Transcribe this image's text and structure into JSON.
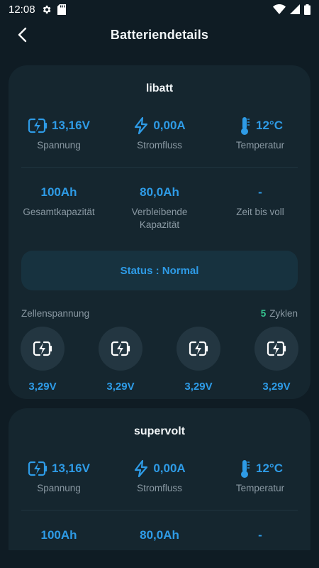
{
  "status_bar": {
    "time": "12:08",
    "icons": [
      "gear-icon",
      "sd-card-icon",
      "wifi-icon",
      "signal-icon",
      "battery-icon"
    ]
  },
  "header": {
    "title": "Batteriendetails",
    "back_icon": "back-arrow-icon"
  },
  "colors": {
    "background": "#0f1c24",
    "card": "#15262f",
    "accent": "#2e9be6",
    "label": "#8a99a3",
    "cycles": "#36c48f"
  },
  "batteries": [
    {
      "name": "libatt",
      "voltage": "13,16V",
      "voltage_label": "Spannung",
      "current": "0,00A",
      "current_label": "Stromfluss",
      "temperature": "12°C",
      "temperature_label": "Temperatur",
      "total_capacity": "100Ah",
      "total_capacity_label": "Gesamtkapazität",
      "remaining_capacity": "80,0Ah",
      "remaining_capacity_label": "Verbleibende Kapazität",
      "time_to_full": "-",
      "time_to_full_label": "Zeit bis voll",
      "status": "Status : Normal",
      "cells_label": "Zellenspannung",
      "cycles_count": "5",
      "cycles_label": "Zyklen",
      "cells": [
        "3,29V",
        "3,29V",
        "3,29V",
        "3,29V"
      ]
    },
    {
      "name": "supervolt",
      "voltage": "13,16V",
      "voltage_label": "Spannung",
      "current": "0,00A",
      "current_label": "Stromfluss",
      "temperature": "12°C",
      "temperature_label": "Temperatur",
      "total_capacity": "100Ah",
      "remaining_capacity": "80,0Ah",
      "time_to_full": "-"
    }
  ]
}
